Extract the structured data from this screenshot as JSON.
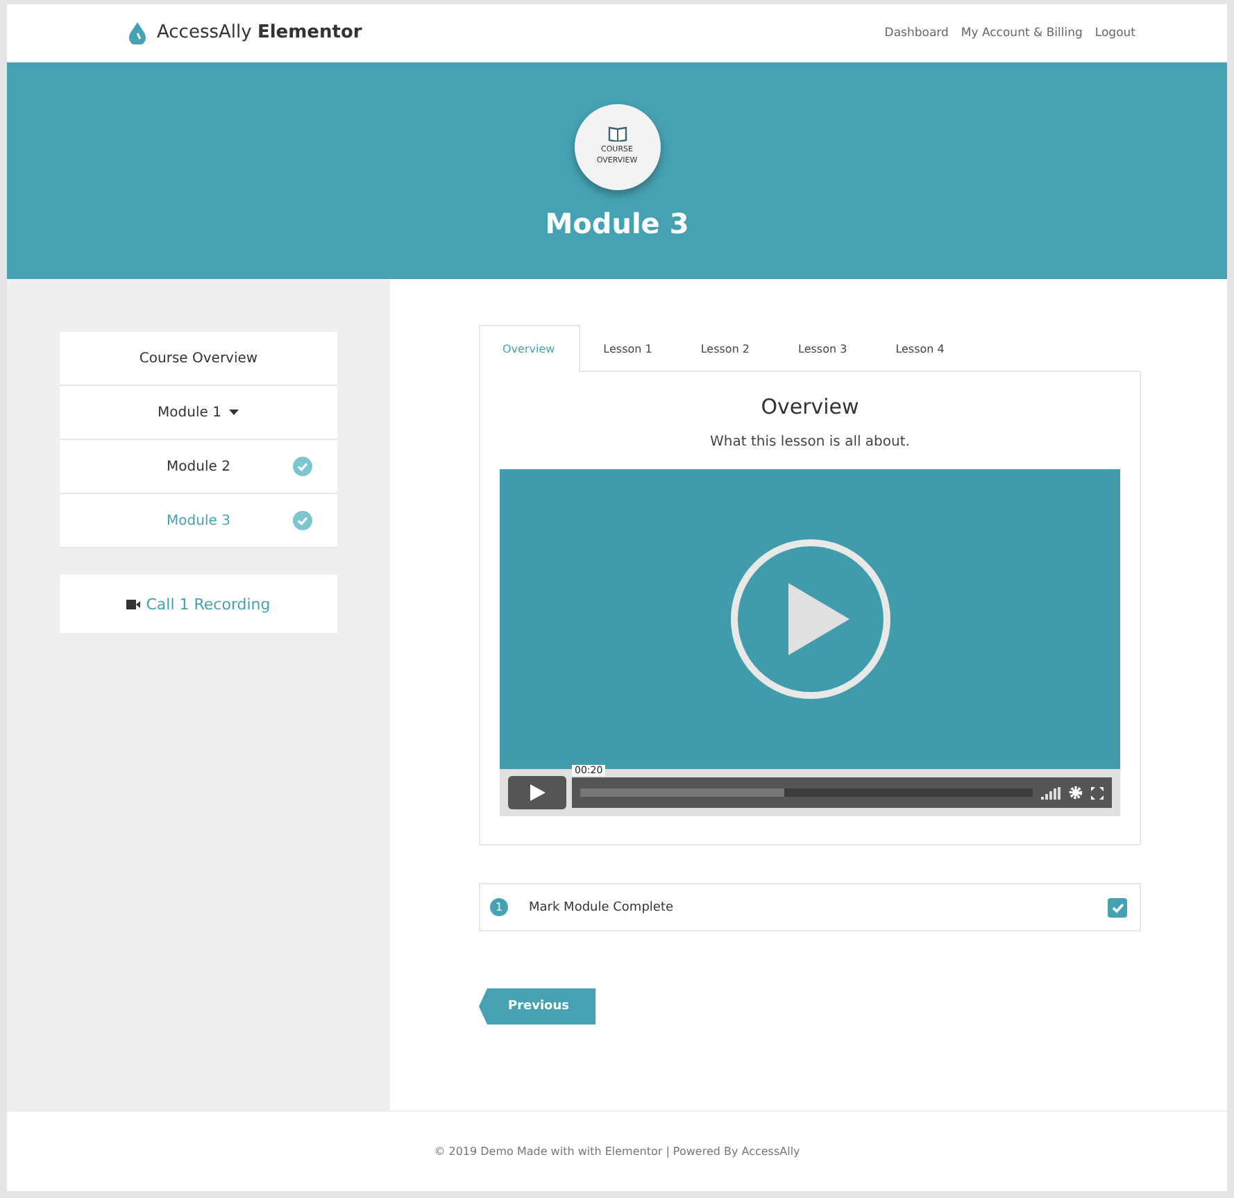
{
  "header": {
    "brand": "AccessAlly **Elementor**",
    "nav": [
      "Dashboard",
      "My Account & Billing",
      "Logout"
    ]
  },
  "banner": {
    "badge": "COURSE OVERVIEW",
    "title": "Module 3"
  },
  "sidebar": {
    "items": [
      {
        "label": "Course Overview",
        "kind": "link",
        "selected": false,
        "completed": false
      },
      {
        "label": "Module 1",
        "kind": "dropdown",
        "selected": false,
        "completed": false
      },
      {
        "label": "Module 2",
        "kind": "link",
        "selected": false,
        "completed": true
      },
      {
        "label": "Module 3",
        "kind": "link",
        "selected": true,
        "completed": true
      }
    ],
    "recording": {
      "label": "Call 1 Recording"
    }
  },
  "tabs": [
    {
      "label": "Overview",
      "selected": true
    },
    {
      "label": "Lesson 1",
      "selected": false
    },
    {
      "label": "Lesson 2",
      "selected": false
    },
    {
      "label": "Lesson 3",
      "selected": false
    },
    {
      "label": "Lesson 4",
      "selected": false
    }
  ],
  "panel": {
    "title": "Overview",
    "subtitle": "What this lesson is all about.",
    "video": {
      "time": "00:20",
      "level": 0.45
    }
  },
  "checklist": [
    {
      "number": "1",
      "label": "Mark Module Complete",
      "checked": true
    }
  ],
  "previous_button": {
    "label": "Previous"
  },
  "footer": "© 2019 Demo Made with with Elementor | Powered By AccessAlly"
}
